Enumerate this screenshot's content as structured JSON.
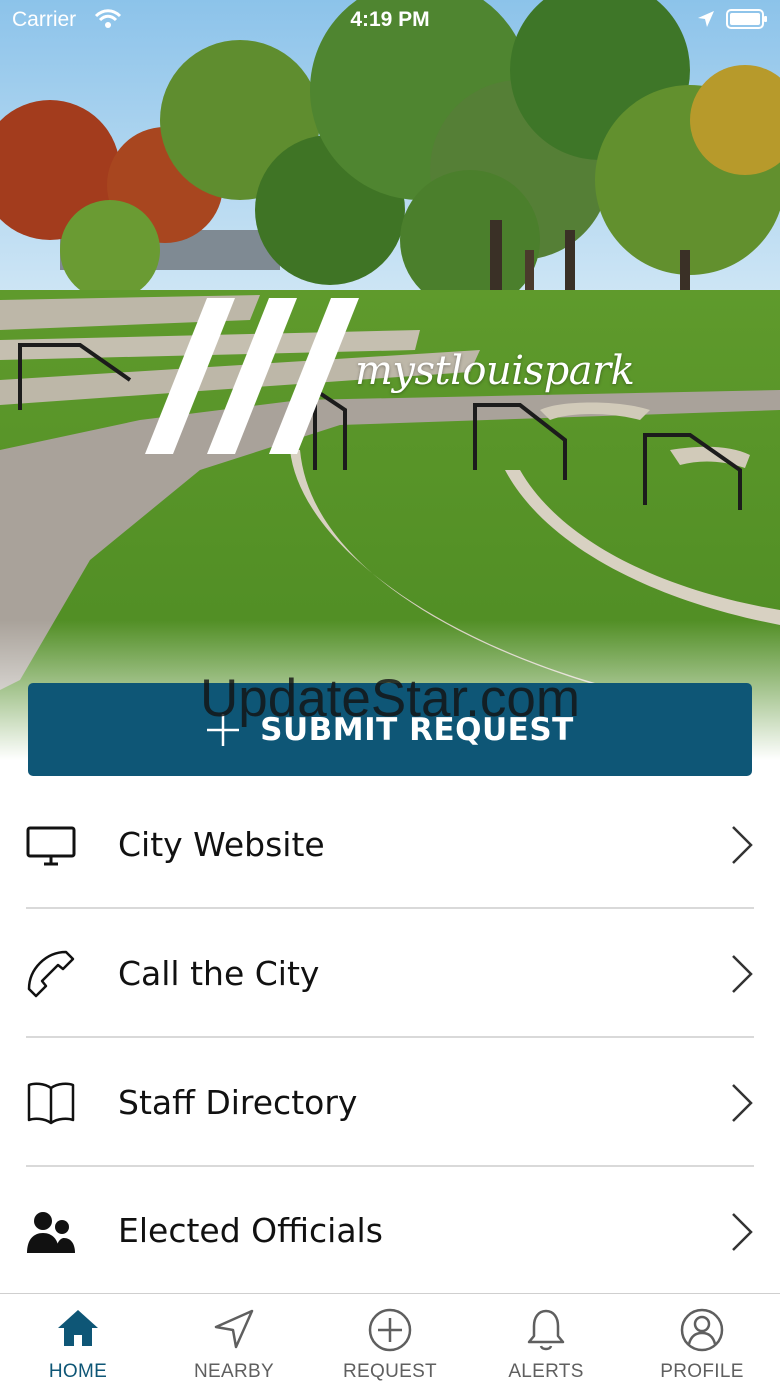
{
  "status_bar": {
    "carrier": "Carrier",
    "time": "4:19 PM"
  },
  "logo": {
    "wordmark": "mystlouispark"
  },
  "submit_button": {
    "label": "SUBMIT REQUEST",
    "icon": "plus-icon"
  },
  "watermark": "UpdateStar.com",
  "menu": {
    "items": [
      {
        "label": "City Website",
        "icon": "monitor-icon"
      },
      {
        "label": "Call the City",
        "icon": "phone-icon"
      },
      {
        "label": "Staff Directory",
        "icon": "book-icon"
      },
      {
        "label": "Elected Officials",
        "icon": "people-icon"
      }
    ]
  },
  "tab_bar": {
    "active": "home",
    "tabs": [
      {
        "label": "HOME",
        "icon": "home-icon"
      },
      {
        "label": "NEARBY",
        "icon": "navigation-arrow-icon"
      },
      {
        "label": "REQUEST",
        "icon": "plus-circle-icon"
      },
      {
        "label": "ALERTS",
        "icon": "bell-icon"
      },
      {
        "label": "PROFILE",
        "icon": "user-circle-icon"
      }
    ]
  },
  "colors": {
    "accent": "#0e5676",
    "tab_inactive": "#5f5f5f",
    "divider": "#d9d9d9"
  }
}
